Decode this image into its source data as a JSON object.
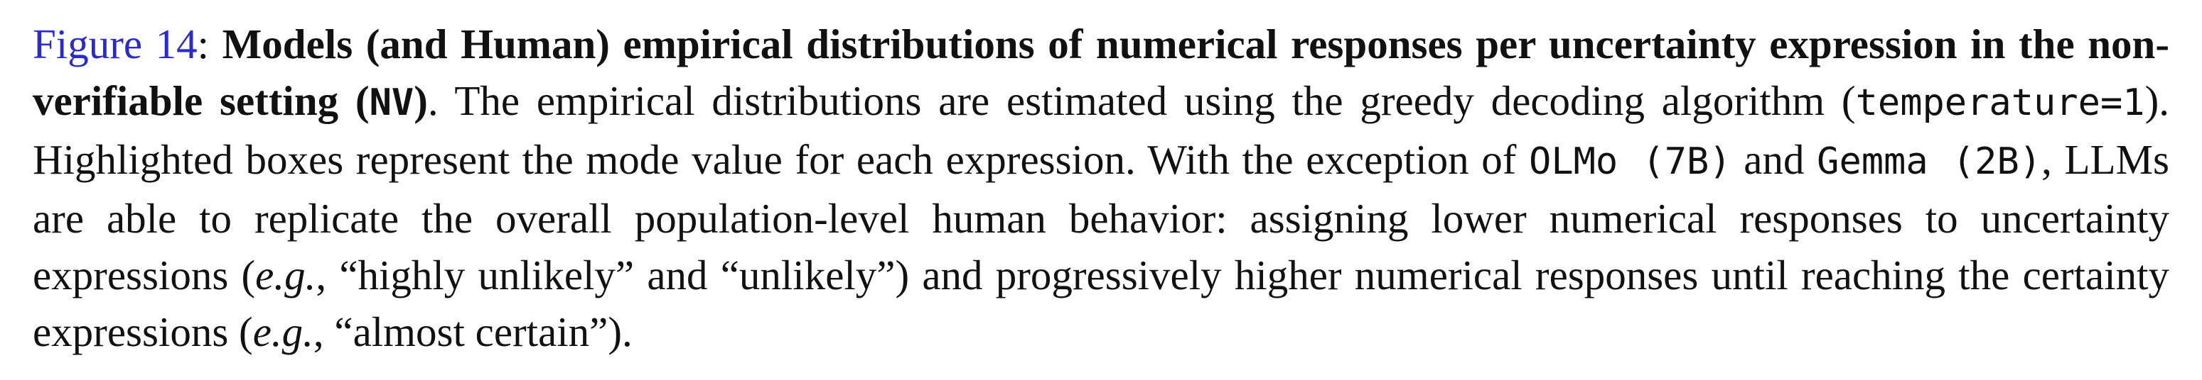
{
  "caption": {
    "figure_ref": "Figure 14",
    "colon": ":",
    "title_bold": "Models (and Human) empirical distributions of numerical responses per uncertainty expression in the non-verifiable setting (",
    "title_code": "NV",
    "title_close": ")",
    "s1": ". The empirical distributions are estimated using the greedy decoding algorithm (",
    "code_temperature": "temperature=1",
    "s2": "). Highlighted boxes represent the mode value for each expression. With the exception of ",
    "code_olmo": "OLMo (7B)",
    "s3": " and ",
    "code_gemma": "Gemma (2B)",
    "s4": ", LLMs are able to replicate the overall population-level human behavior: assigning lower numerical responses to uncertainty expressions (",
    "eg1": "e.g.",
    "s5": ", “highly unlikely” and “unlikely”) and progressively higher numerical responses until reaching the certainty expressions (",
    "eg2": "e.g.",
    "s6": ", “almost certain”)."
  }
}
